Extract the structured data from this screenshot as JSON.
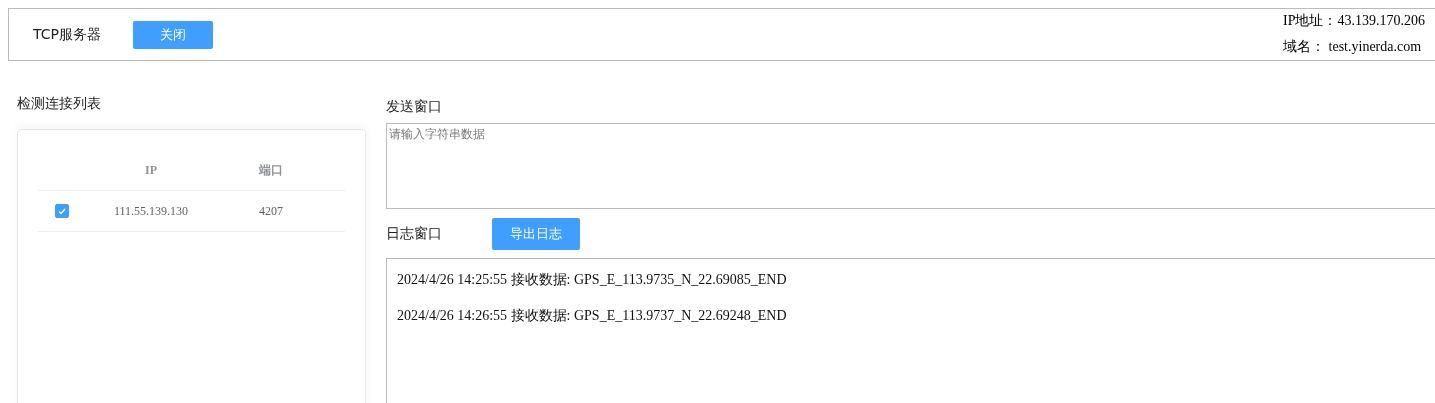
{
  "header": {
    "title": "TCP服务器",
    "close_button": "关闭",
    "ip_address": "IP地址：43.139.170.206",
    "domain": "域名： test.yinerda.com"
  },
  "connections": {
    "title": "检测连接列表",
    "columns": [
      "IP",
      "端口"
    ],
    "rows": [
      {
        "checked": true,
        "ip": "111.55.139.130",
        "port": "4207"
      }
    ]
  },
  "send": {
    "title": "发送窗口",
    "placeholder": "请输入字符串数据"
  },
  "log": {
    "title": "日志窗口",
    "export_button": "导出日志",
    "lines": [
      "2024/4/26 14:25:55 接收数据: GPS_E_113.9735_N_22.69085_END",
      "2024/4/26 14:26:55 接收数据: GPS_E_113.9737_N_22.69248_END"
    ]
  }
}
